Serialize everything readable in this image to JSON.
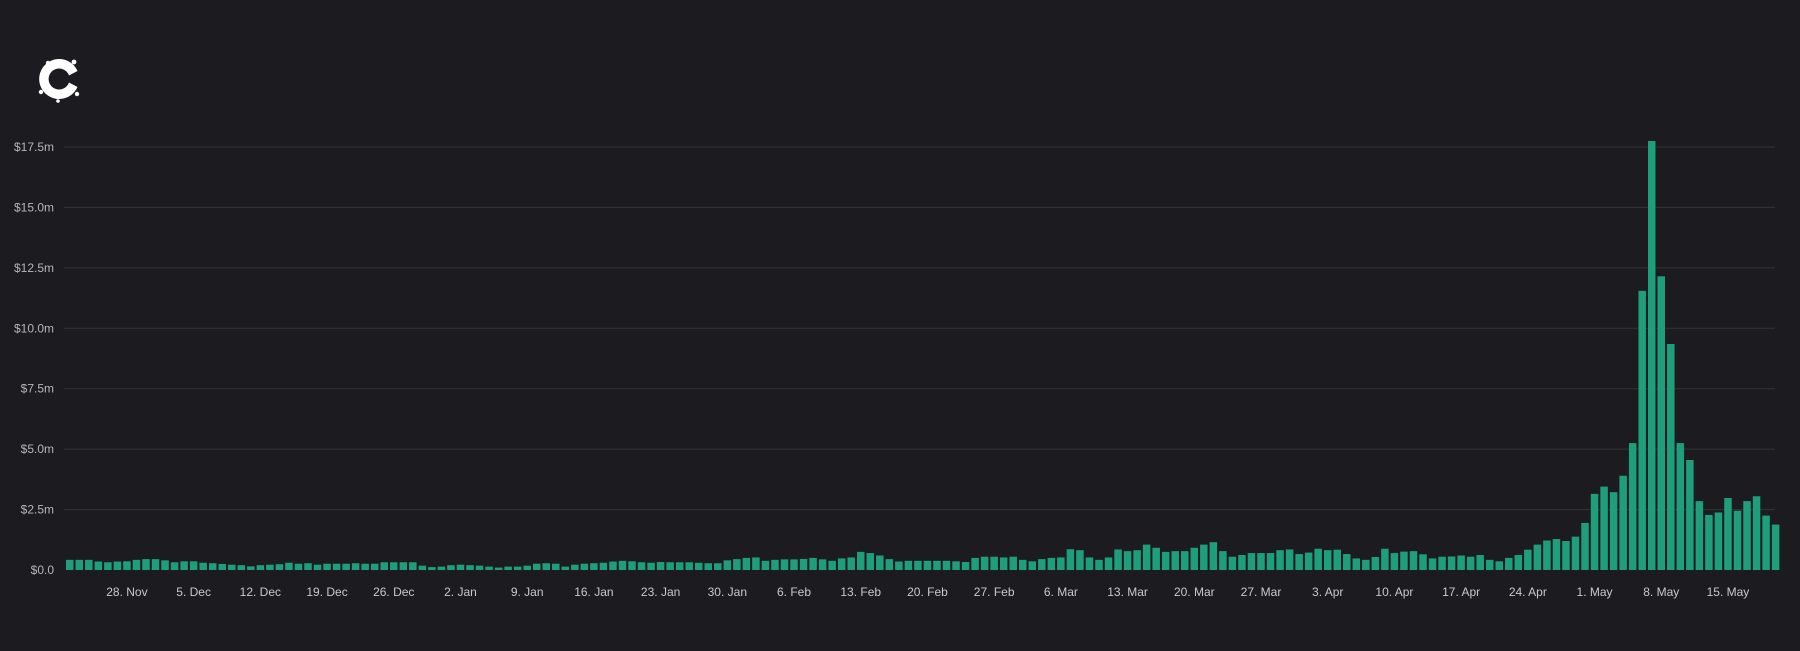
{
  "logo": {
    "icon": "c-logo-icon"
  },
  "colors": {
    "background": "#1c1b20",
    "bar": "#1f9e7c",
    "grid": "#34333a",
    "text": "#b6b5bc"
  },
  "chart_data": {
    "type": "bar",
    "grid": true,
    "ylim": [
      0,
      17.5
    ],
    "y_ticks": [
      {
        "value": 17.5,
        "label": "$17.5m"
      },
      {
        "value": 15.0,
        "label": "$15.0m"
      },
      {
        "value": 12.5,
        "label": "$12.5m"
      },
      {
        "value": 10.0,
        "label": "$10.0m"
      },
      {
        "value": 7.5,
        "label": "$7.5m"
      },
      {
        "value": 5.0,
        "label": "$5.0m"
      },
      {
        "value": 2.5,
        "label": "$2.5m"
      },
      {
        "value": 0,
        "label": "$0.0"
      }
    ],
    "x_tick_labels": [
      {
        "index": 6,
        "label": "28. Nov"
      },
      {
        "index": 13,
        "label": "5. Dec"
      },
      {
        "index": 20,
        "label": "12. Dec"
      },
      {
        "index": 27,
        "label": "19. Dec"
      },
      {
        "index": 34,
        "label": "26. Dec"
      },
      {
        "index": 41,
        "label": "2. Jan"
      },
      {
        "index": 48,
        "label": "9. Jan"
      },
      {
        "index": 55,
        "label": "16. Jan"
      },
      {
        "index": 62,
        "label": "23. Jan"
      },
      {
        "index": 69,
        "label": "30. Jan"
      },
      {
        "index": 76,
        "label": "6. Feb"
      },
      {
        "index": 83,
        "label": "13. Feb"
      },
      {
        "index": 90,
        "label": "20. Feb"
      },
      {
        "index": 97,
        "label": "27. Feb"
      },
      {
        "index": 104,
        "label": "6. Mar"
      },
      {
        "index": 111,
        "label": "13. Mar"
      },
      {
        "index": 118,
        "label": "20. Mar"
      },
      {
        "index": 125,
        "label": "27. Mar"
      },
      {
        "index": 132,
        "label": "3. Apr"
      },
      {
        "index": 139,
        "label": "10. Apr"
      },
      {
        "index": 146,
        "label": "17. Apr"
      },
      {
        "index": 153,
        "label": "24. Apr"
      },
      {
        "index": 160,
        "label": "1. May"
      },
      {
        "index": 167,
        "label": "8. May"
      },
      {
        "index": 174,
        "label": "15. May"
      }
    ],
    "values": [
      0.42,
      0.42,
      0.42,
      0.35,
      0.32,
      0.35,
      0.36,
      0.42,
      0.45,
      0.45,
      0.4,
      0.32,
      0.36,
      0.36,
      0.3,
      0.28,
      0.25,
      0.22,
      0.2,
      0.15,
      0.2,
      0.22,
      0.24,
      0.3,
      0.26,
      0.28,
      0.22,
      0.26,
      0.26,
      0.26,
      0.28,
      0.26,
      0.26,
      0.32,
      0.32,
      0.32,
      0.32,
      0.18,
      0.12,
      0.14,
      0.2,
      0.22,
      0.2,
      0.18,
      0.14,
      0.1,
      0.14,
      0.14,
      0.18,
      0.26,
      0.28,
      0.26,
      0.14,
      0.22,
      0.26,
      0.28,
      0.3,
      0.35,
      0.38,
      0.36,
      0.32,
      0.3,
      0.33,
      0.32,
      0.32,
      0.32,
      0.3,
      0.28,
      0.28,
      0.4,
      0.45,
      0.5,
      0.52,
      0.38,
      0.42,
      0.44,
      0.44,
      0.46,
      0.5,
      0.44,
      0.38,
      0.48,
      0.52,
      0.75,
      0.7,
      0.6,
      0.45,
      0.35,
      0.38,
      0.38,
      0.38,
      0.38,
      0.38,
      0.36,
      0.33,
      0.5,
      0.55,
      0.55,
      0.52,
      0.55,
      0.42,
      0.36,
      0.45,
      0.5,
      0.52,
      0.86,
      0.82,
      0.52,
      0.42,
      0.52,
      0.85,
      0.78,
      0.82,
      1.05,
      0.92,
      0.75,
      0.78,
      0.78,
      0.92,
      1.05,
      1.15,
      0.78,
      0.55,
      0.62,
      0.7,
      0.7,
      0.7,
      0.82,
      0.85,
      0.66,
      0.72,
      0.88,
      0.82,
      0.84,
      0.66,
      0.48,
      0.42,
      0.54,
      0.88,
      0.7,
      0.76,
      0.78,
      0.65,
      0.48,
      0.55,
      0.56,
      0.6,
      0.55,
      0.62,
      0.42,
      0.36,
      0.5,
      0.62,
      0.84,
      1.05,
      1.22,
      1.28,
      1.2,
      1.38,
      1.95,
      3.15,
      3.45,
      3.22,
      3.9,
      5.25,
      11.55,
      17.75,
      12.15,
      9.35,
      5.25,
      4.55,
      2.85,
      2.28,
      2.38,
      2.98,
      2.45,
      2.85,
      3.05,
      2.25,
      1.88
    ]
  }
}
